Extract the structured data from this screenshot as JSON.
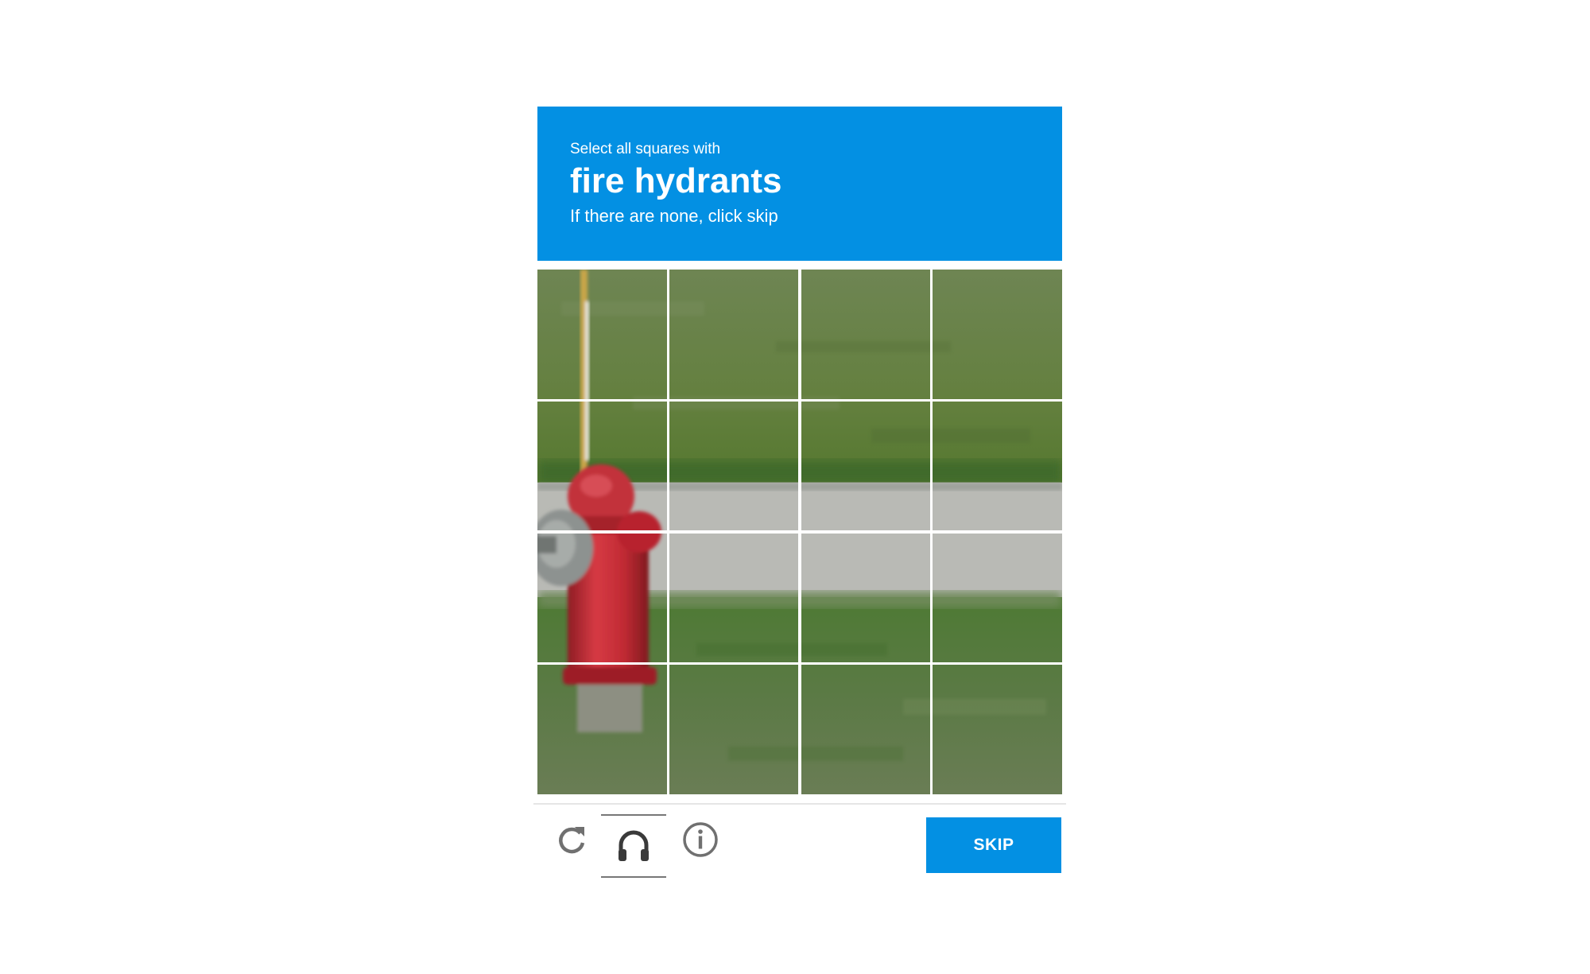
{
  "header": {
    "instruction": "Select all squares with",
    "target": "fire hydrants",
    "hint": "If there are none, click skip"
  },
  "grid": {
    "rows": 4,
    "cols": 4,
    "image_subject": "red fire hydrant on grass beside a road"
  },
  "footer": {
    "reload_icon": "reload-icon",
    "audio_icon": "headphones-icon",
    "info_icon": "info-icon",
    "skip_label": "SKIP"
  },
  "colors": {
    "accent": "#0390e3",
    "grass": "#5f7a44",
    "road": "#b9bab5",
    "hydrant": "#c42c35"
  }
}
